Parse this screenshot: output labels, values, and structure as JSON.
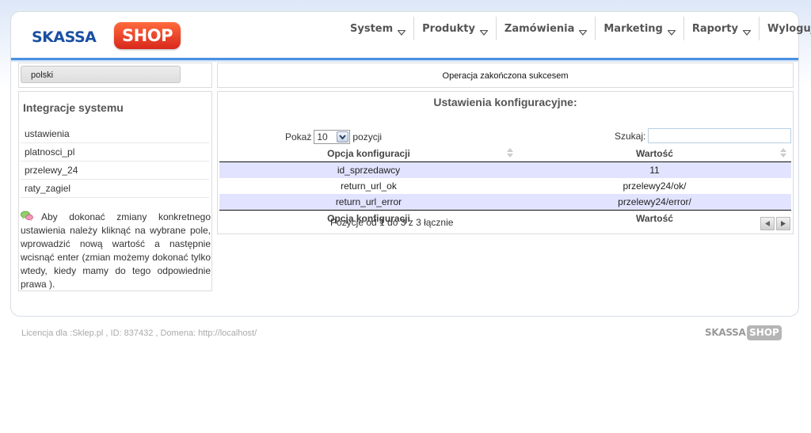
{
  "brand": {
    "logo_left": "SKASSA",
    "logo_right": "SHOP"
  },
  "nav": [
    {
      "label": "System",
      "dropdown": true
    },
    {
      "label": "Produkty",
      "dropdown": true
    },
    {
      "label": "Zamówienia",
      "dropdown": true
    },
    {
      "label": "Marketing",
      "dropdown": true
    },
    {
      "label": "Raporty",
      "dropdown": true
    },
    {
      "label": "Wyloguj",
      "dropdown": false
    }
  ],
  "language": {
    "selected": "polski"
  },
  "sidebar": {
    "title": "Integracje systemu",
    "items": [
      {
        "label": "ustawienia"
      },
      {
        "label": "platnosci_pl"
      },
      {
        "label": "przelewy_24"
      },
      {
        "label": "raty_zagiel"
      }
    ],
    "help_text": "Aby dokonać zmiany konkretnego ustawienia należy kliknąć na wybrane pole, wprowadzić nową wartość a następnie wcisnąć enter (zmian możemy dokonać tylko wtedy, kiedy mamy do tego odpowiednie prawa )."
  },
  "message": {
    "text": "Operacja zakończona sukcesem"
  },
  "config": {
    "title": "Ustawienia konfiguracyjne:",
    "show_label": "Pokaż",
    "page_length": "10",
    "entries_label": "pozycji",
    "search_label": "Szukaj:",
    "search_value": "",
    "columns": [
      "Opcja konfiguracji",
      "Wartość"
    ],
    "rows": [
      [
        "id_sprzedawcy",
        "11"
      ],
      [
        "return_url_ok",
        "przelewy24/ok/"
      ],
      [
        "return_url_error",
        "przelewy24/error/"
      ]
    ],
    "info": "Pozycje od 1 do 3 z 3 łącznie"
  },
  "footer": {
    "license_text": "Licencja dla :Sklep.pl , ID: 837432 , Domena: http://localhost/",
    "logo_left": "SKASSA",
    "logo_right": "SHOP"
  },
  "colors": {
    "accent": "#4a90e2",
    "logo_red": "#e0341f",
    "row_highlight": "#e2e4ff"
  }
}
